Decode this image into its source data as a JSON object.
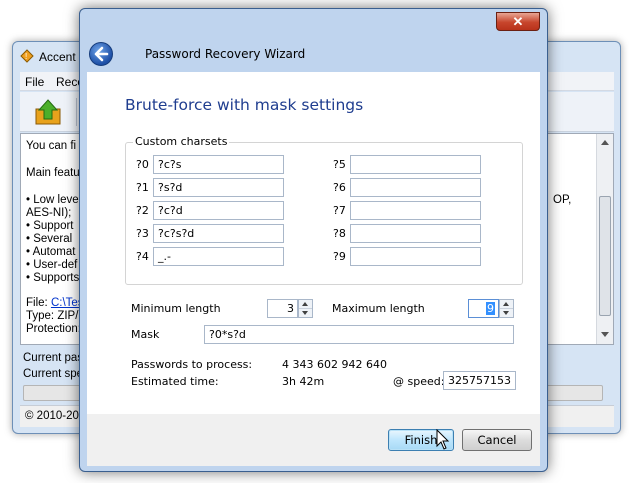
{
  "background_window": {
    "title": "Accent ",
    "menu": [
      "File",
      "Reco"
    ],
    "content_lines": [
      "You can fi",
      "Main featu",
      "• Low leve",
      "AES-NI);",
      "• Support",
      "• Several",
      "• Automat",
      "• User-def",
      "• Supports"
    ],
    "file_label": "File:",
    "file_link": "C:\\Tes",
    "type_line": "Type: ZIP/(",
    "protection_line": "Protection:",
    "right_text": "OP,",
    "status_current_pass": "Current pas",
    "status_current_speed": "Current spe",
    "footer": "© 2010-201"
  },
  "dialog": {
    "window_title": "Password Recovery Wizard",
    "close_glyph": "✕",
    "heading": "Brute-force with mask settings",
    "custom_charsets": {
      "label": "Custom charsets",
      "left": [
        {
          "label": "?0",
          "value": "?c?s"
        },
        {
          "label": "?1",
          "value": "?s?d"
        },
        {
          "label": "?2",
          "value": "?c?d"
        },
        {
          "label": "?3",
          "value": "?c?s?d"
        },
        {
          "label": "?4",
          "value": "_.-"
        }
      ],
      "right": [
        {
          "label": "?5",
          "value": ""
        },
        {
          "label": "?6",
          "value": ""
        },
        {
          "label": "?7",
          "value": ""
        },
        {
          "label": "?8",
          "value": ""
        },
        {
          "label": "?9",
          "value": ""
        }
      ]
    },
    "min_length_label": "Minimum length",
    "min_length_value": "3",
    "max_length_label": "Maximum length",
    "max_length_value": "9",
    "mask_label": "Mask",
    "mask_value": "?0*s?d",
    "passwords_label": "Passwords to process:",
    "passwords_value": "4 343 602 942 640",
    "estimated_label": "Estimated time:",
    "estimated_value": "3h 42m",
    "speed_label": "@ speed:",
    "speed_value": "325757153",
    "finish_label": "Finish",
    "cancel_label": "Cancel"
  },
  "colors": {
    "heading": "#1f3d8f",
    "link": "#0033cc",
    "close_button": "#c7452c",
    "selection": "#3390ff"
  }
}
